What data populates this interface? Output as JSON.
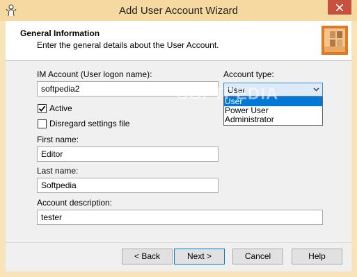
{
  "window": {
    "title": "Add User Account Wizard"
  },
  "header": {
    "title": "General Information",
    "subtitle": "Enter the general details about the User Account."
  },
  "form": {
    "im_account_label": "IM Account (User logon name):",
    "im_account_value": "softpedia2",
    "active_label": "Active",
    "active_checked": true,
    "disregard_label": "Disregard settings file",
    "disregard_checked": false,
    "first_name_label": "First name:",
    "first_name_value": "Editor",
    "last_name_label": "Last name:",
    "last_name_value": "Softpedia",
    "description_label": "Account description:",
    "description_value": "tester",
    "account_type_label": "Account type:",
    "account_type_value": "User",
    "account_type_options": [
      "User",
      "Power User",
      "Administrator"
    ],
    "account_type_selected_index": 0
  },
  "watermark": "SOFTPEDIA",
  "buttons": {
    "back": "< Back",
    "next": "Next >",
    "cancel": "Cancel",
    "help": "Help"
  },
  "colors": {
    "title_bar": "#f6d9a0",
    "accent": "#0078d7",
    "close": "#c7503f"
  }
}
